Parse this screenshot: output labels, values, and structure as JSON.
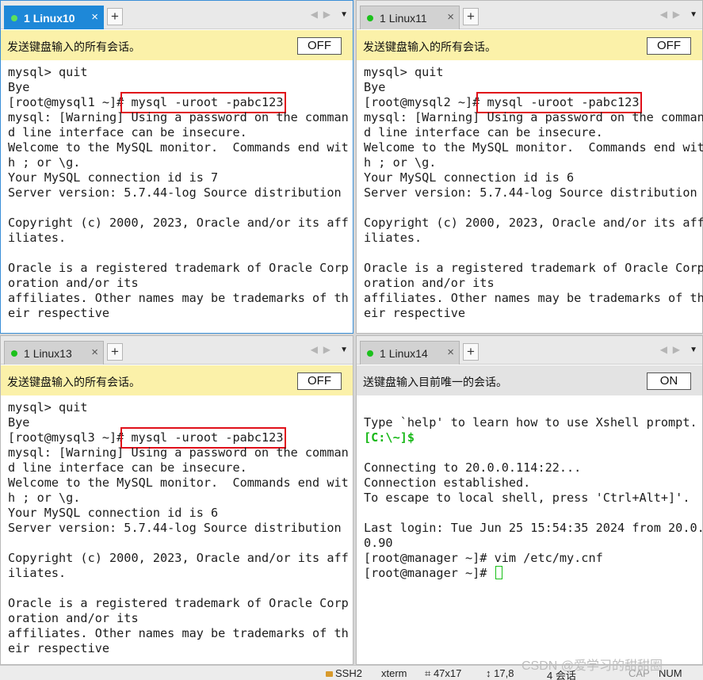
{
  "panes": [
    {
      "tab": {
        "index": "1",
        "name": "Linux10",
        "close": "×",
        "add": "+"
      },
      "send_text": "发送键盘输入的所有会话。",
      "toggle": "OFF",
      "terminal": [
        "mysql> quit",
        "Bye",
        "[root@mysql1 ~]#",
        "mysql: [Warning] Using a password on the comman",
        "d line interface can be insecure.",
        "Welcome to the MySQL monitor.  Commands end wit",
        "h ; or \\g.",
        "Your MySQL connection id is 7",
        "Server version: 5.7.44-log Source distribution",
        "",
        "Copyright (c) 2000, 2023, Oracle and/or its aff",
        "iliates.",
        "",
        "Oracle is a registered trademark of Oracle Corp",
        "oration and/or its",
        "affiliates. Other names may be trademarks of th",
        "eir respective"
      ],
      "highlight": " mysql -uroot -pabc123"
    },
    {
      "tab": {
        "index": "1",
        "name": "Linux11",
        "close": "×",
        "add": "+"
      },
      "send_text": "发送键盘输入的所有会话。",
      "toggle": "OFF",
      "terminal": [
        "mysql> quit",
        "Bye",
        "[root@mysql2 ~]#",
        "mysql: [Warning] Using a password on the comman",
        "d line interface can be insecure.",
        "Welcome to the MySQL monitor.  Commands end wit",
        "h ; or \\g.",
        "Your MySQL connection id is 6",
        "Server version: 5.7.44-log Source distribution",
        "",
        "Copyright (c) 2000, 2023, Oracle and/or its aff",
        "iliates.",
        "",
        "Oracle is a registered trademark of Oracle Corp",
        "oration and/or its",
        "affiliates. Other names may be trademarks of th",
        "eir respective"
      ],
      "highlight": " mysql -uroot -pabc123"
    },
    {
      "tab": {
        "index": "1",
        "name": "Linux13",
        "close": "×",
        "add": "+"
      },
      "send_text": "发送键盘输入的所有会话。",
      "toggle": "OFF",
      "terminal": [
        "mysql> quit",
        "Bye",
        "[root@mysql3 ~]#",
        "mysql: [Warning] Using a password on the comman",
        "d line interface can be insecure.",
        "Welcome to the MySQL monitor.  Commands end wit",
        "h ; or \\g.",
        "Your MySQL connection id is 6",
        "Server version: 5.7.44-log Source distribution",
        "",
        "Copyright (c) 2000, 2023, Oracle and/or its aff",
        "iliates.",
        "",
        "Oracle is a registered trademark of Oracle Corp",
        "oration and/or its",
        "affiliates. Other names may be trademarks of th",
        "eir respective"
      ],
      "highlight": " mysql -uroot -pabc123"
    },
    {
      "tab": {
        "index": "1",
        "name": "Linux14",
        "close": "×",
        "add": "+"
      },
      "send_text": "送键盘输入目前唯一的会话。",
      "toggle": "ON",
      "terminal": [
        "",
        "Type `help' to learn how to use Xshell prompt.",
        "[C:\\~]$",
        "",
        "Connecting to 20.0.0.114:22...",
        "Connection established.",
        "To escape to local shell, press 'Ctrl+Alt+]'.",
        "",
        "Last login: Tue Jun 25 15:54:35 2024 from 20.0.",
        "0.90",
        "[root@manager ~]# vim /etc/my.cnf",
        "[root@manager ~]# "
      ]
    }
  ],
  "statusbar": {
    "protocol": "SSH2",
    "terminal_type": "xterm",
    "size": "47x17",
    "position": "17,8",
    "sessions": "4 会话",
    "caps": "CAP",
    "num": "NUM"
  },
  "watermark": "CSDN @爱学习的甜甜圈",
  "colors": {
    "active_tab": "#1e88d8",
    "send_bar": "#fbf1a9",
    "highlight_box": "#e0101a",
    "prompt_green": "#18b818"
  },
  "icons": [
    "session-dot-icon",
    "close-icon",
    "add-tab-icon",
    "prev-arrow-icon",
    "next-arrow-icon",
    "menu-chevron-icon",
    "lock-icon",
    "cursor-icon"
  ]
}
